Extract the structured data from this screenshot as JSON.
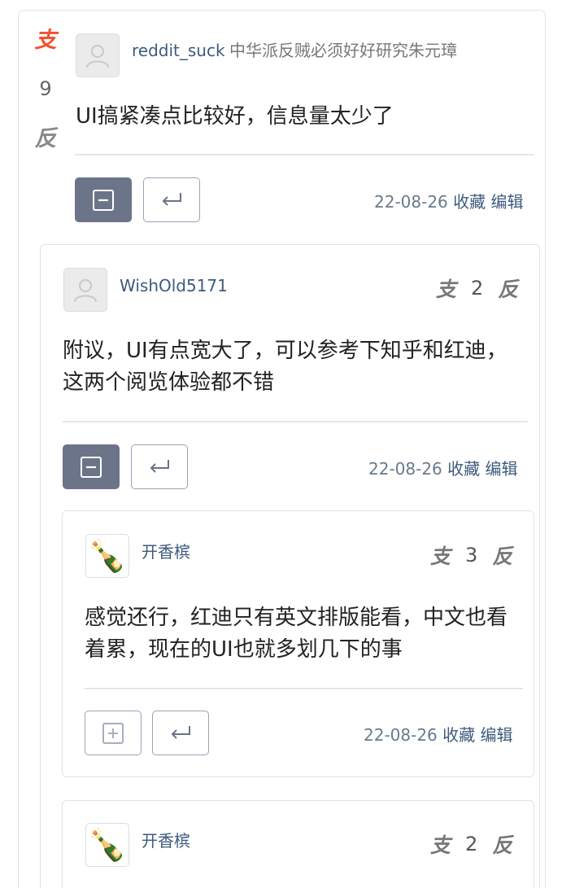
{
  "top_comment": {
    "vote_support": "支",
    "vote_count": "9",
    "vote_oppose": "反",
    "username": "reddit_suck",
    "signature": "中华派反贼必须好好研究朱元璋",
    "text": "UI搞紧凑点比较好，信息量太少了",
    "date": "22-08-26",
    "favorite": "收藏",
    "edit": "编辑"
  },
  "reply_1": {
    "username": "WishOld5171",
    "vote_support": "支",
    "vote_count": "2",
    "vote_oppose": "反",
    "text_line1": "附议，UI有点宽大了，可以参考下知乎和红迪，",
    "text_line2": "这两个阅览体验都不错",
    "date": "22-08-26",
    "favorite": "收藏",
    "edit": "编辑"
  },
  "reply_2": {
    "avatar_emoji": "🍾",
    "username": "开香槟",
    "vote_support": "支",
    "vote_count": "3",
    "vote_oppose": "反",
    "text_line1": "感觉还行，红迪只有英文排版能看，中文也看",
    "text_line2": "着累，现在的UI也就多划几下的事",
    "date": "22-08-26",
    "favorite": "收藏",
    "edit": "编辑"
  },
  "reply_3": {
    "avatar_emoji": "🍾",
    "username": "开香槟",
    "vote_support": "支",
    "vote_count": "2",
    "vote_oppose": "反"
  },
  "colors": {
    "accent_support": "#f0522e",
    "username": "#3d5b7d",
    "button_dark": "#6c7489"
  }
}
